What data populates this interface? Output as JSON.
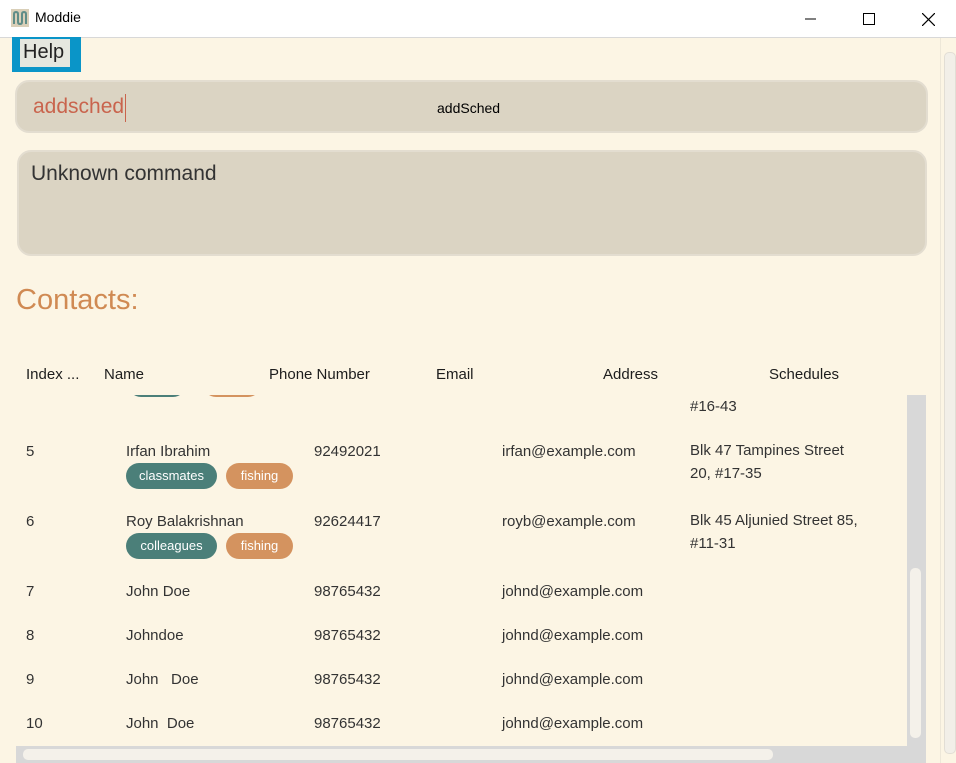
{
  "window": {
    "title": "Moddie"
  },
  "menu": {
    "help_label": "Help"
  },
  "command": {
    "value": "addsched",
    "suggestion": "addSched"
  },
  "result": {
    "text": "Unknown command"
  },
  "contacts": {
    "heading": "Contacts:",
    "columns": [
      "Index ...",
      "Name",
      "Phone Number",
      "Email",
      "Address",
      "Schedules"
    ],
    "partial_row": {
      "address": "#16-43",
      "tag_colors": [
        "#4b7f79",
        "#d4935f"
      ]
    },
    "rows": [
      {
        "index": "5",
        "name": "Irfan Ibrahim",
        "phone": "92492021",
        "email": "irfan@example.com",
        "address": "Blk 47 Tampines Street 20, #17-35",
        "tags": [
          {
            "label": "classmates",
            "color": "#4b7f79"
          },
          {
            "label": "fishing",
            "color": "#d4935f"
          }
        ]
      },
      {
        "index": "6",
        "name": "Roy Balakrishnan",
        "phone": "92624417",
        "email": "royb@example.com",
        "address": "Blk 45 Aljunied Street 85, #11-31",
        "tags": [
          {
            "label": "colleagues",
            "color": "#4b7f79"
          },
          {
            "label": "fishing",
            "color": "#d4935f"
          }
        ]
      },
      {
        "index": "7",
        "name": "John Doe",
        "phone": "98765432",
        "email": "johnd@example.com",
        "address": "",
        "tags": []
      },
      {
        "index": "8",
        "name": "Johndoe",
        "phone": "98765432",
        "email": "johnd@example.com",
        "address": "",
        "tags": []
      },
      {
        "index": "9",
        "name": "John   Doe",
        "phone": "98765432",
        "email": "johnd@example.com",
        "address": "",
        "tags": []
      },
      {
        "index": "10",
        "name": "John  Doe",
        "phone": "98765432",
        "email": "johnd@example.com",
        "address": "",
        "tags": []
      }
    ]
  },
  "colors": {
    "accent": "#d08a53",
    "command_text": "#c9644d",
    "help_border": "#0a95c8",
    "background": "#fcf5e4"
  }
}
